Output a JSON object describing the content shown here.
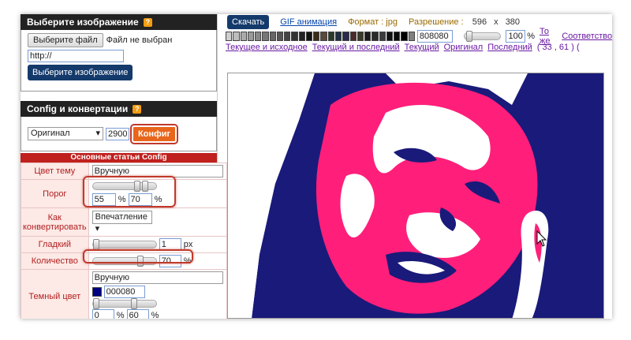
{
  "select_image": {
    "header": "Выберите изображение",
    "help": "?",
    "choose_file_btn": "Выберите файл",
    "no_file_text": "Файл не выбран",
    "url_value": "http://",
    "submit_btn": "Выберите изображение"
  },
  "config_convert": {
    "header": "Config и конвертации",
    "help": "?",
    "mode_value": "Оригинал",
    "size_value": "2900",
    "config_btn": "Конфиг"
  },
  "config_table": {
    "header": "Основные статьи Config",
    "rows": {
      "theme": {
        "label": "Цвет тему",
        "value": "Вручную"
      },
      "threshold": {
        "label": "Порог",
        "from": "55",
        "to": "70",
        "unit": "%",
        "slider_from": 55,
        "slider_to": 70
      },
      "convert": {
        "label": "Как конвертировать",
        "value": "Впечатление"
      },
      "smooth": {
        "label": "Гладкий",
        "value": "1",
        "unit": "px",
        "slider": 1
      },
      "amount": {
        "label": "Количество",
        "value": "70",
        "unit": "%",
        "slider": 70
      },
      "dark": {
        "label": "Темный цвет",
        "mode": "Вручную",
        "color": "000080",
        "from": "0",
        "to": "60",
        "unit": "%",
        "slider_to": 60
      }
    }
  },
  "toolbar": {
    "download": "Скачать",
    "gif": "GIF анимация",
    "format_label": "Формат : jpg",
    "resolution_label": "Разрешение :",
    "width": "596",
    "x": "x",
    "height": "380",
    "color_value": "808080",
    "zoom_value": "100",
    "zoom_unit": "%",
    "same": "То же",
    "match": "Соответство",
    "links": [
      "Текущее и исходное",
      "Текущий и последний",
      "Текущий",
      "Оригинал",
      "Последний"
    ],
    "coords": "( 33 , 61 ) ("
  },
  "palette": [
    "#cfcfcf",
    "#bdbdbd",
    "#aaaaaa",
    "#999999",
    "#888888",
    "#777777",
    "#666666",
    "#555555",
    "#444444",
    "#333333",
    "#222222",
    "#111111",
    "#3b2a1a",
    "#5b4a3a",
    "#2a3b2a",
    "#1f2f3f",
    "#2a2a4a",
    "#4a2a2a",
    "#3a3a2a",
    "#1a1a1a",
    "#2b2b2b",
    "#3c3c3c",
    "#101010",
    "#0a0a0a",
    "#000000",
    "#808080"
  ],
  "colors": {
    "pink": "#ff1f7a",
    "navy": "#1a1a7a",
    "white": "#ffffff"
  }
}
